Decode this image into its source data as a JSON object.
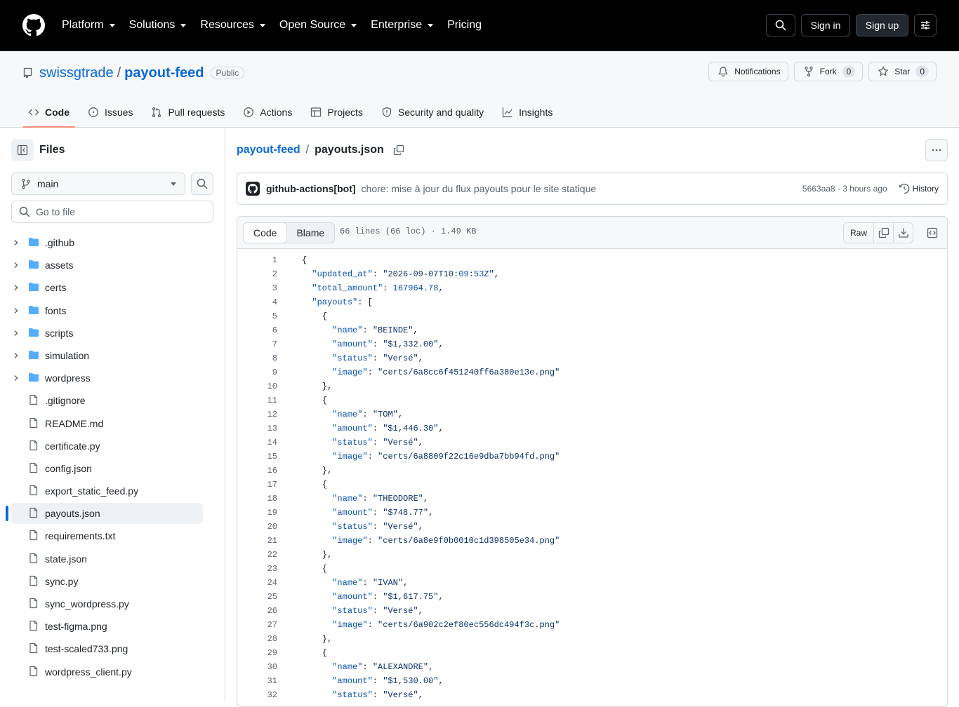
{
  "header": {
    "nav": [
      {
        "label": "Platform",
        "dropdown": true
      },
      {
        "label": "Solutions",
        "dropdown": true
      },
      {
        "label": "Resources",
        "dropdown": true
      },
      {
        "label": "Open Source",
        "dropdown": true
      },
      {
        "label": "Enterprise",
        "dropdown": true
      },
      {
        "label": "Pricing",
        "dropdown": false
      }
    ],
    "sign_in": "Sign in",
    "sign_up": "Sign up"
  },
  "repo": {
    "owner": "swissgtrade",
    "separator": "/",
    "name": "payout-feed",
    "visibility": "Public",
    "notifications_label": "Notifications",
    "fork_label": "Fork",
    "fork_count": "0",
    "star_label": "Star",
    "star_count": "0",
    "tabs": [
      {
        "label": "Code",
        "icon": "code-icon",
        "active": true
      },
      {
        "label": "Issues",
        "icon": "issue-icon",
        "active": false
      },
      {
        "label": "Pull requests",
        "icon": "pull-request-icon",
        "active": false
      },
      {
        "label": "Actions",
        "icon": "play-icon",
        "active": false
      },
      {
        "label": "Projects",
        "icon": "table-icon",
        "active": false
      },
      {
        "label": "Security and quality",
        "icon": "shield-icon",
        "active": false
      },
      {
        "label": "Insights",
        "icon": "graph-icon",
        "active": false
      }
    ]
  },
  "sidebar": {
    "title": "Files",
    "branch": "main",
    "goto_placeholder": "Go to file",
    "tree": [
      {
        "label": ".github",
        "type": "dir"
      },
      {
        "label": "assets",
        "type": "dir"
      },
      {
        "label": "certs",
        "type": "dir"
      },
      {
        "label": "fonts",
        "type": "dir"
      },
      {
        "label": "scripts",
        "type": "dir"
      },
      {
        "label": "simulation",
        "type": "dir"
      },
      {
        "label": "wordpress",
        "type": "dir"
      },
      {
        "label": ".gitignore",
        "type": "file"
      },
      {
        "label": "README.md",
        "type": "file"
      },
      {
        "label": "certificate.py",
        "type": "file"
      },
      {
        "label": "config.json",
        "type": "file"
      },
      {
        "label": "export_static_feed.py",
        "type": "file"
      },
      {
        "label": "payouts.json",
        "type": "file",
        "selected": true
      },
      {
        "label": "requirements.txt",
        "type": "file"
      },
      {
        "label": "state.json",
        "type": "file"
      },
      {
        "label": "sync.py",
        "type": "file"
      },
      {
        "label": "sync_wordpress.py",
        "type": "file"
      },
      {
        "label": "test-figma.png",
        "type": "file"
      },
      {
        "label": "test-scaled733.png",
        "type": "file"
      },
      {
        "label": "wordpress_client.py",
        "type": "file"
      }
    ]
  },
  "breadcrumb": {
    "root": "payout-feed",
    "separator": "/",
    "file": "payouts.json"
  },
  "commit": {
    "author": "github-actions[bot]",
    "message": "chore: mise à jour du flux payouts pour le site statique",
    "meta": "5663aa8 · 3 hours ago",
    "history_label": "History"
  },
  "file_view": {
    "tab_code": "Code",
    "tab_blame": "Blame",
    "stats": "66 lines (66 loc) · 1.49 KB",
    "raw_label": "Raw",
    "lines": [
      "{",
      "  \"updated_at\": \"2026-09-07T10:09:53Z\",",
      "  \"total_amount\": 167964.78,",
      "  \"payouts\": [",
      "    {",
      "      \"name\": \"BEINDE\",",
      "      \"amount\": \"$1,332.00\",",
      "      \"status\": \"Versé\",",
      "      \"image\": \"certs/6a8cc6f451240ff6a380e13e.png\"",
      "    },",
      "    {",
      "      \"name\": \"TOM\",",
      "      \"amount\": \"$1,446.30\",",
      "      \"status\": \"Versé\",",
      "      \"image\": \"certs/6a8809f22c16e9dba7bb94fd.png\"",
      "    },",
      "    {",
      "      \"name\": \"THEODORE\",",
      "      \"amount\": \"$748.77\",",
      "      \"status\": \"Versé\",",
      "      \"image\": \"certs/6a8e9f0b0010c1d398505e34.png\"",
      "    },",
      "    {",
      "      \"name\": \"IVAN\",",
      "      \"amount\": \"$1,617.75\",",
      "      \"status\": \"Versé\",",
      "      \"image\": \"certs/6a902c2ef80ec556dc494f3c.png\"",
      "    },",
      "    {",
      "      \"name\": \"ALEXANDRE\",",
      "      \"amount\": \"$1,530.00\",",
      "      \"status\": \"Versé\","
    ]
  },
  "colors": {
    "header_bg": "#000000",
    "link": "#0969da",
    "active_tab_underline": "#fd8c73",
    "folder": "#54aeff",
    "json_key": "#0550ae",
    "json_string": "#0a3069"
  }
}
